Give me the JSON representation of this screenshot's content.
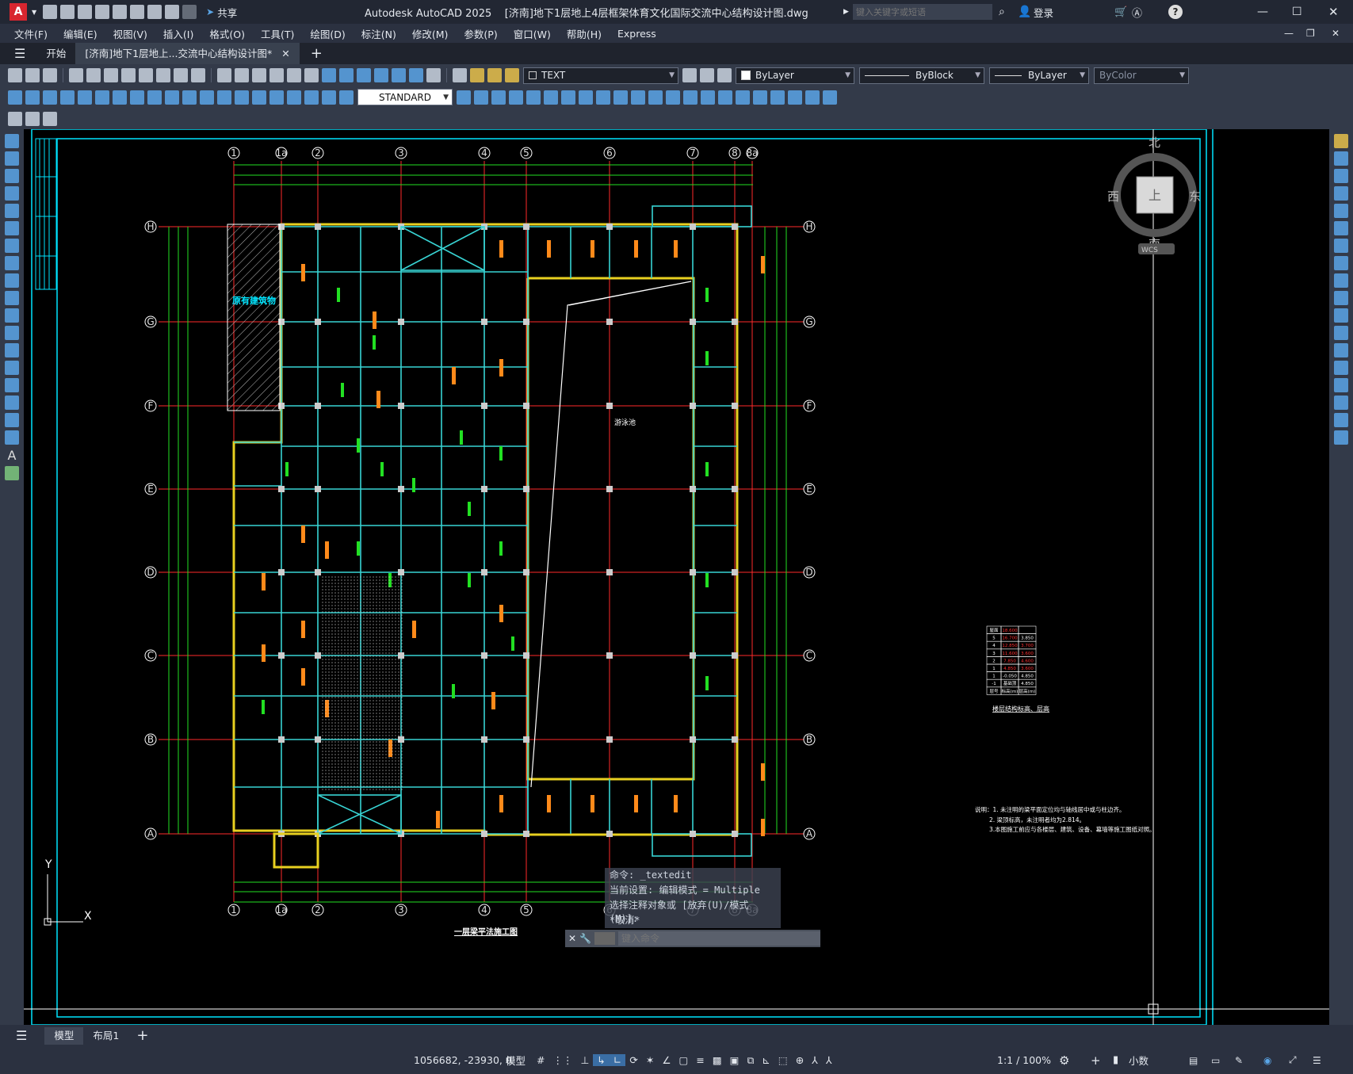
{
  "app": {
    "title": "Autodesk AutoCAD 2025",
    "document": "[济南]地下1层地上4层框架体育文化国际交流中心结构设计图.dwg",
    "share_label": "共享",
    "search_placeholder": "键入关键字或短语",
    "login_label": "登录"
  },
  "menu": [
    "文件(F)",
    "编辑(E)",
    "视图(V)",
    "插入(I)",
    "格式(O)",
    "工具(T)",
    "绘图(D)",
    "标注(N)",
    "修改(M)",
    "参数(P)",
    "窗口(W)",
    "帮助(H)",
    "Express"
  ],
  "tabs": {
    "start": "开始",
    "active": "[济南]地下1层地上...交流中心结构设计图*"
  },
  "toolbar": {
    "layer_name": "TEXT",
    "color": "ByLayer",
    "linetype": "ByBlock",
    "lineweight": "ByLayer",
    "plotstyle": "ByColor",
    "dim_style": "STANDARD"
  },
  "viewcube": {
    "north": "北",
    "south": "南",
    "east": "东",
    "west": "西",
    "top": "上",
    "wcs": "WCS"
  },
  "drawing": {
    "col_labels": [
      "1",
      "1a",
      "2",
      "3",
      "4",
      "5",
      "6",
      "7",
      "8",
      "8a"
    ],
    "row_labels": [
      "H",
      "G",
      "F",
      "E",
      "D",
      "C",
      "B",
      "A"
    ],
    "existing_building": "原有建筑物",
    "pool_label": "游泳池",
    "sheet_title": "一层梁平法施工图",
    "notes": [
      "说明：1. 未注明的梁平面定位均与轴线居中或与柱边齐。",
      "2. 梁顶标高，未注明者均为2.814。",
      "3.本图施工前应与各楼层、建筑、设备、幕墙等施工图纸对照。"
    ],
    "table_title": "楼层结构标高、层高",
    "table_rows": [
      [
        "屋面",
        "18.600",
        ""
      ],
      [
        "5",
        "16.700",
        "3.850"
      ],
      [
        "4",
        "12.850",
        "3.700"
      ],
      [
        "3",
        "11.600",
        "3.600"
      ],
      [
        "2",
        "7.850",
        "4.600"
      ],
      [
        "1",
        "4.850",
        "3.600"
      ],
      [
        "1",
        "-0.050",
        "4.850"
      ],
      [
        "-1",
        "基础顶",
        "4.850"
      ],
      [
        "层号",
        "标高(m)",
        "层高(m)"
      ]
    ],
    "ucs_y": "Y",
    "ucs_x": "X"
  },
  "command": {
    "line1": "命令: _textedit",
    "line2": "当前设置: 编辑模式 = Multiple",
    "line3": "选择注释对象或 [放弃(U)/模式(M)]:",
    "line4": "*取消*",
    "input_placeholder": "键入命令"
  },
  "layouts": {
    "model": "模型",
    "layout1": "布局1",
    "add": "+"
  },
  "status": {
    "coords": "1056682, -23930, 0",
    "space": "模型",
    "scale": "1:1 / 100%",
    "units": "小数"
  },
  "colors": {
    "grid_red": "#ff2a2a",
    "beam_cyan": "#38d4d4",
    "dim_green": "#22e022",
    "label_orange": "#ff8a1a",
    "wall_yellow": "#e8d020",
    "border_cyan": "#00e5ff"
  }
}
